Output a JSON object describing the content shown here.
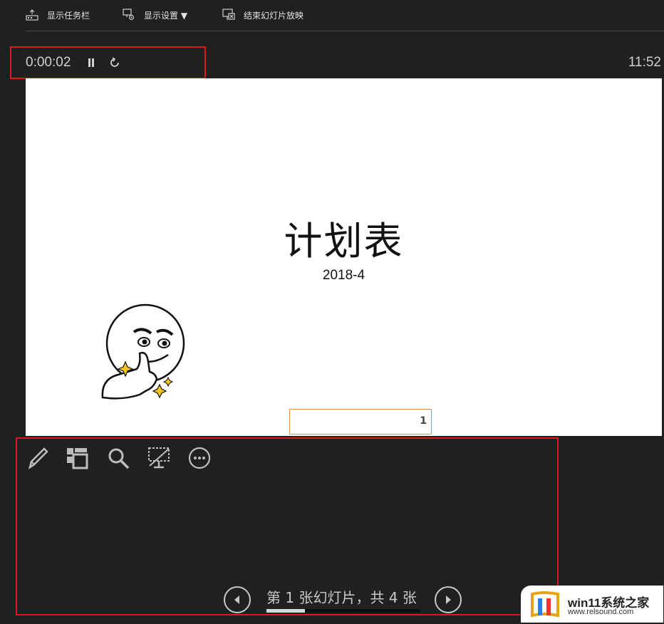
{
  "toolbar": {
    "show_taskbar": "显示任务栏",
    "display_settings": "显示设置 ▼",
    "end_slideshow": "结束幻灯片放映"
  },
  "timer": {
    "elapsed": "0:00:02",
    "clock": "11:52"
  },
  "slide": {
    "title": "计划表",
    "subtitle": "2018-4",
    "number": "1"
  },
  "navigation": {
    "slide_count": "第 1 张幻灯片，共 4 张",
    "progress": 0.25
  },
  "watermark": {
    "brand": "win11系统之家",
    "url": "www.relsound.com"
  },
  "icons": [
    "taskbar-icon",
    "display-settings-icon",
    "end-slideshow-icon",
    "pause-icon",
    "restart-icon",
    "pen-icon",
    "see-all-slides-icon",
    "zoom-icon",
    "black-screen-icon",
    "more-options-icon",
    "previous-icon",
    "next-icon"
  ],
  "colors": {
    "background": "#202020",
    "highlight_box": "#e01818",
    "slide_bg": "#ffffff"
  }
}
